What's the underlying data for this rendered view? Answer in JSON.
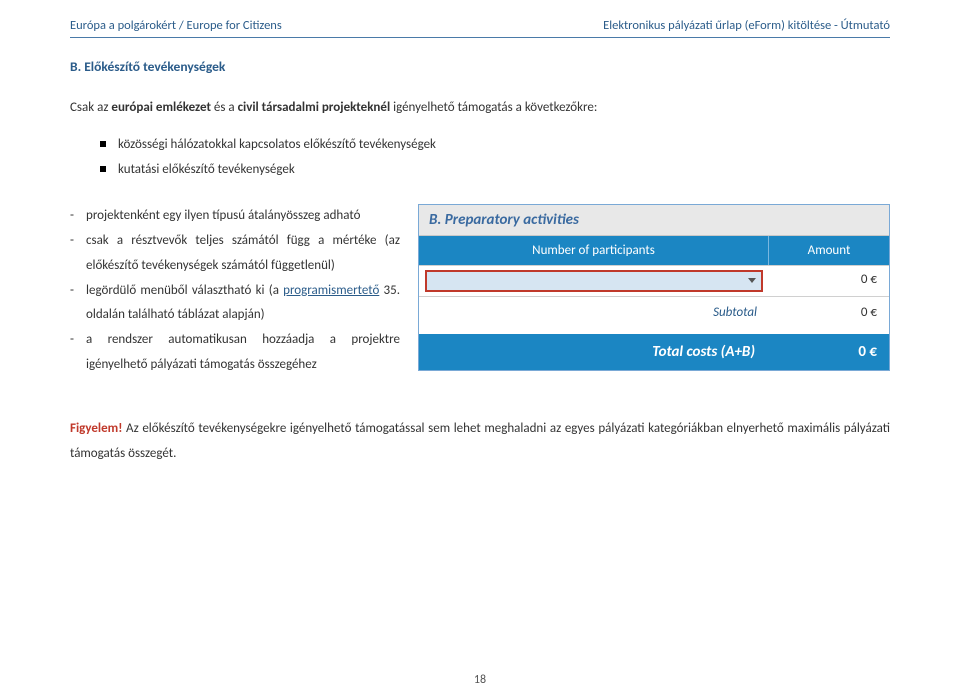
{
  "header": {
    "left": "Európa a polgárokért / Europe for Citizens",
    "right": "Elektronikus pályázati űrlap (eForm) kitöltése - Útmutató"
  },
  "section": {
    "title": "B. Előkészítő tevékenységek"
  },
  "intro": {
    "pre": "Csak az ",
    "b1": "európai emlékezet",
    "mid": " és a ",
    "b2": "civil társadalmi projekteknél",
    "post": " igényelhető támogatás a következőkre:"
  },
  "bullets": {
    "b1": "közösségi hálózatokkal kapcsolatos előkészítő tevékenységek",
    "b2": "kutatási előkészítő tevékenységek"
  },
  "dash": {
    "d1": "projektenként egy ilyen típusú átalányösszeg adható",
    "d2": "csak a résztvevők teljes számától függ a mértéke (az előkészítő tevékenységek számától függetlenül)",
    "d3a": "legördülő menüből választható ki (a ",
    "d3link": "programismertető",
    "d3b": " 35. oldalán található táblázat alapján)",
    "d4": "a rendszer automatikusan hozzáadja a projektre igényelhető pályázati támogatás összegéhez"
  },
  "panel": {
    "title": "B. Preparatory activities",
    "col_participants": "Number of participants",
    "col_amount": "Amount",
    "row_amount": "0 €",
    "subtotal_label": "Subtotal",
    "subtotal_amount": "0 €",
    "total_label": "Total costs (A+B)",
    "total_amount": "0 €"
  },
  "warning": {
    "lead": "Figyelem!",
    "text": " Az előkészítő tevékenységekre igényelhető támogatással sem lehet meghaladni az egyes pályázati kategóriákban elnyerhető maximális pályázati támogatás összegét."
  },
  "page_number": "18"
}
